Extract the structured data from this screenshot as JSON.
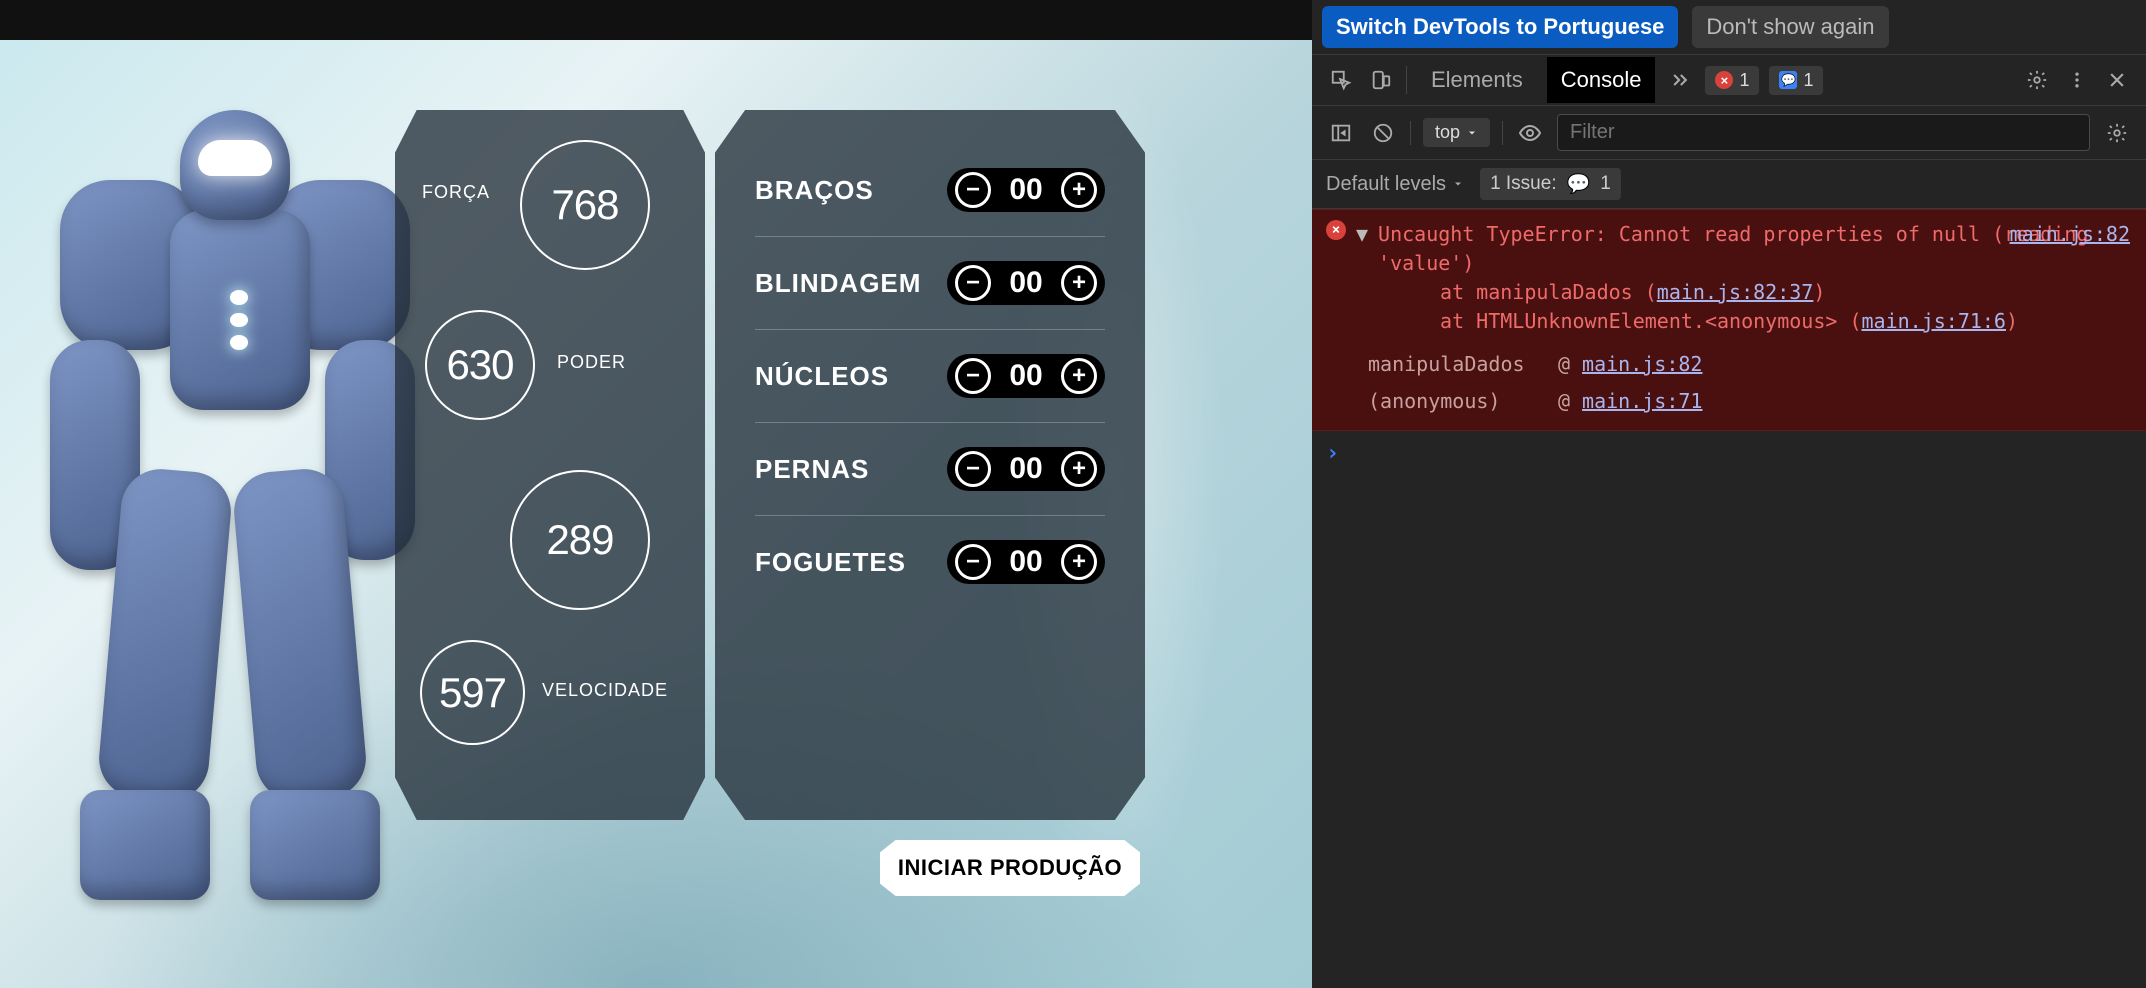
{
  "game": {
    "stats": [
      {
        "label": "FORÇA",
        "value": "768"
      },
      {
        "label": "PODER",
        "value": "630"
      },
      {
        "label": "",
        "value": "289"
      },
      {
        "label": "VELOCIDADE",
        "value": "597"
      }
    ],
    "parts": [
      {
        "label": "BRAÇOS",
        "value": "00"
      },
      {
        "label": "BLINDAGEM",
        "value": "00"
      },
      {
        "label": "NÚCLEOS",
        "value": "00"
      },
      {
        "label": "PERNAS",
        "value": "00"
      },
      {
        "label": "FOGUETES",
        "value": "00"
      }
    ],
    "start_label": "INICIAR PRODUÇÃO"
  },
  "devtools": {
    "banner": {
      "primary": "Switch DevTools to Portuguese",
      "secondary": "Don't show again"
    },
    "tabs": {
      "elements": "Elements",
      "console": "Console",
      "more_count": "",
      "error_count": "1",
      "message_count": "1"
    },
    "toolbar": {
      "context": "top",
      "filter_placeholder": "Filter"
    },
    "filterbar": {
      "levels": "Default levels",
      "issues_label": "1 Issue:",
      "issues_count": "1"
    },
    "error": {
      "header": "Uncaught TypeError: Cannot read properties of null (reading 'value')",
      "loc": "main.js:82",
      "stack1_pre": "at manipulaDados (",
      "stack1_link": "main.js:82:37",
      "stack1_post": ")",
      "stack2_pre": "at HTMLUnknownElement.<anonymous> (",
      "stack2_link": "main.js:71:6",
      "stack2_post": ")",
      "trace": [
        {
          "fn": "manipulaDados",
          "link": "main.js:82"
        },
        {
          "fn": "(anonymous)",
          "link": "main.js:71"
        }
      ]
    },
    "prompt": "›"
  }
}
